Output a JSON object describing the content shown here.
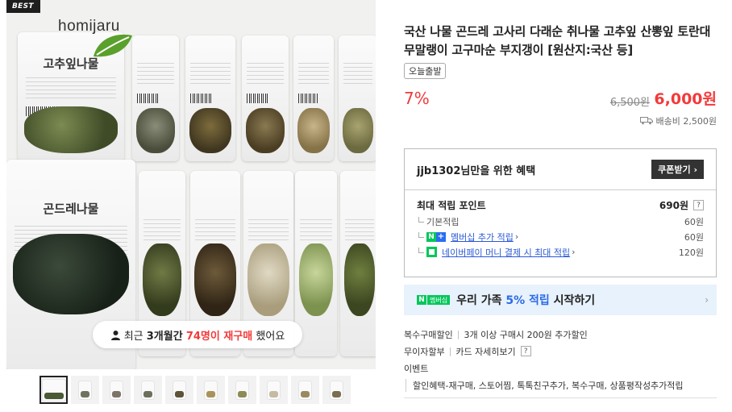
{
  "gallery": {
    "best_badge": "BEST",
    "brand": "homijaru",
    "bag_labels": {
      "top_left": "고추잎나물",
      "bottom_left": "곤드레나물"
    },
    "repurchase": {
      "prefix": "최근",
      "period": "3개월간",
      "count": "74명이 재구매",
      "suffix": "했어요"
    },
    "thumb_count": 10
  },
  "product": {
    "title": "국산 나물 곤드레 고사리 다래순 취나물 고추잎 산뽕잎 토란대 무말랭이 고구마순 부지갱이 [원산지:국산 등]",
    "tag": "오늘출발",
    "discount": "7%",
    "original_price": "6,500원",
    "sale_price": "6,000원",
    "shipping": "배송비 2,500원"
  },
  "benefit": {
    "header": "jjb1302님만을 위한 혜택",
    "coupon_button": "쿠폰받기 ›",
    "max_points_label": "최대 적립 포인트",
    "max_points_value": "690원",
    "help": "?",
    "rows": [
      {
        "label": "기본적립",
        "value": "60원"
      },
      {
        "label": "멤버십 추가 적립",
        "value": "60원"
      },
      {
        "label": "네이버페이 머니 결제 시 최대 적립",
        "value": "120원"
      }
    ],
    "arrow": "›"
  },
  "banner": {
    "badge_n": "N",
    "badge_mem": "멤버십",
    "text_prefix": "우리 가족",
    "text_highlight": "5% 적립",
    "text_suffix": "시작하기",
    "chevron": "›"
  },
  "misc": {
    "row1_label": "복수구매할인",
    "row1_value": "3개 이상 구매시 200원 추가할인",
    "row2_label": "무이자할부",
    "row2_value": "카드 자세히보기",
    "row2_help": "?",
    "row3_label": "이벤트",
    "row4_value": "할인혜택-재구매, 스토어찜, 톡톡친구추가, 복수구매, 상품평작성추가적립"
  },
  "colors": {
    "accent_red": "#f33a3a",
    "naver_green": "#03c75a",
    "link_blue": "#2b5ad6",
    "banner_bg": "#e8f2fc"
  }
}
